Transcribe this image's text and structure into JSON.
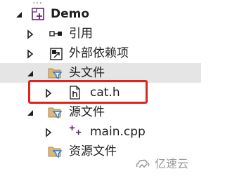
{
  "tree": {
    "partial_top": "…",
    "project": {
      "label": "Demo",
      "icon": "project-icon"
    },
    "items": [
      {
        "label": "引用",
        "icon": "references-icon",
        "expanded": false
      },
      {
        "label": "外部依赖项",
        "icon": "external-deps-icon",
        "expanded": false
      },
      {
        "label": "头文件",
        "icon": "filter-folder-icon",
        "expanded": true,
        "selected": true
      },
      {
        "label": "cat.h",
        "icon": "header-file-icon",
        "expanded": false
      },
      {
        "label": "源文件",
        "icon": "filter-folder-icon",
        "expanded": true
      },
      {
        "label": "main.cpp",
        "icon": "cpp-file-icon",
        "expanded": false
      },
      {
        "label": "资源文件",
        "icon": "filter-folder-icon"
      }
    ]
  },
  "colors": {
    "selected_row": "#e5e5e5",
    "highlight_border": "#e2231a",
    "folder_yellow": "#dcb67a",
    "filter_blue": "#1e7bd8",
    "project_purple": "#68217a"
  },
  "watermark": {
    "text": "亿速云",
    "icon": "yisu-cloud-logo"
  }
}
